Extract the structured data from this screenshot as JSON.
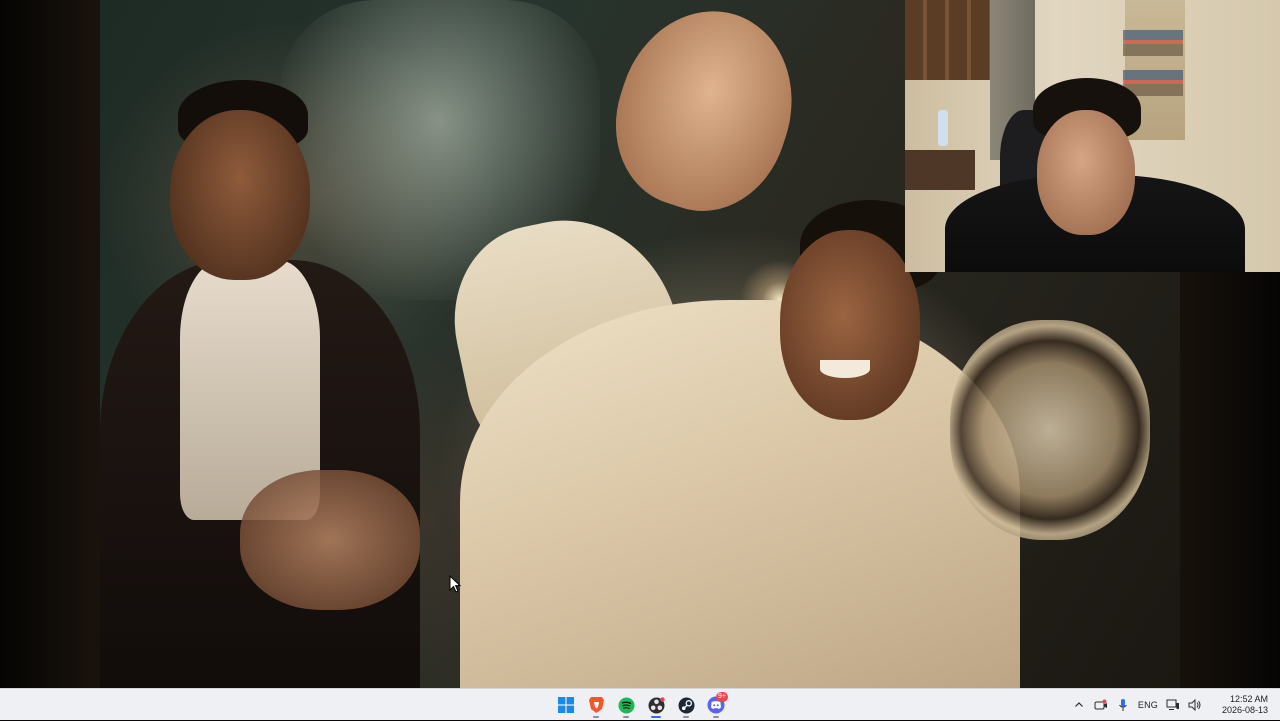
{
  "video": {
    "description_hidden": ""
  },
  "taskbar": {
    "apps": [
      {
        "name": "start-button",
        "icon": "windows-logo-icon"
      },
      {
        "name": "brave-browser",
        "icon": "brave-lion-icon",
        "color": "#fb542b"
      },
      {
        "name": "spotify",
        "icon": "spotify-icon",
        "color": "#1db954"
      },
      {
        "name": "obs-studio",
        "icon": "obs-icon",
        "color": "#302e31"
      },
      {
        "name": "steam",
        "icon": "steam-icon",
        "color": "#1b2838"
      },
      {
        "name": "discord",
        "icon": "discord-icon",
        "color": "#5865f2",
        "badge": "9+"
      }
    ],
    "tray": {
      "chevron": "^",
      "language": "ENG",
      "time": "12:52 AM",
      "date": "2026-08-13"
    }
  },
  "colors": {
    "taskbar_bg": "#eef0f4",
    "accent": "#2f6fde"
  }
}
